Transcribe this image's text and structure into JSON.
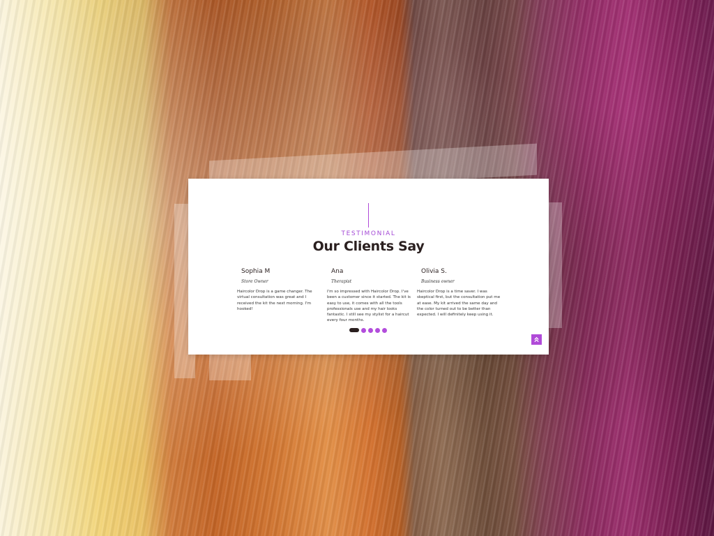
{
  "background": {
    "description_colors": [
      "#f6e6a8",
      "#c56a2d",
      "#7d6457",
      "#9b2f6d"
    ]
  },
  "section": {
    "eyebrow": "TESTIMONIAL",
    "title": "Our Clients Say"
  },
  "testimonials": [
    {
      "name": "Sophia M",
      "role": "Store Owner",
      "quote": "Haircolor Drop is a game changer. The virtual consultation was great and I received the kit the next morning. I'm hooked!"
    },
    {
      "name": "Ana",
      "role": "Therapist",
      "quote": "I'm so impressed with Haircolor Drop. I've been a customer since it started. The kit is easy to use, it comes with all the tools professionals use and my hair looks fantastic. I still see my stylist for a haircut every four months."
    },
    {
      "name": "Olivia S.",
      "role": "Business owner",
      "quote": "Haircolor Drop is a time saver. I was skeptical first, but the consultation put me at ease. My kit arrived the same day and the color turned out to be better than expected. I will definitely keep using it."
    }
  ],
  "carousel": {
    "slide_count": 5,
    "active_index": 0
  },
  "colors": {
    "accent": "#b04ad8",
    "heading": "#2a1f1f"
  },
  "icons": {
    "scroll_top": "double-chevron-up-icon"
  }
}
